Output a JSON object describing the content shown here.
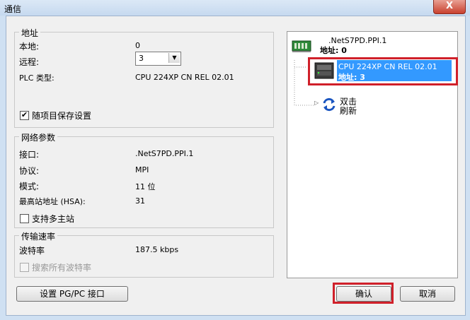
{
  "window": {
    "title": "通信",
    "close_glyph": "X"
  },
  "address": {
    "legend": "地址",
    "local_label": "本地:",
    "local_value": "0",
    "remote_label": "远程:",
    "remote_value": "3",
    "plc_type_label": "PLC 类型:",
    "plc_type_value": "CPU 224XP CN REL 02.01",
    "save_with_project_label": "随项目保存设置",
    "save_with_project_checked": true
  },
  "network": {
    "legend": "网络参数",
    "interface_label": "接口:",
    "interface_value": ".NetS7PD.PPI.1",
    "protocol_label": "协议:",
    "protocol_value": "MPI",
    "mode_label": "模式:",
    "mode_value": "11 位",
    "hsa_label": "最高站地址 (HSA):",
    "hsa_value": "31",
    "multi_master_label": "支持多主站",
    "multi_master_checked": false
  },
  "baud": {
    "legend": "传输速率",
    "baud_label": "波特率",
    "baud_value": "187.5 kbps",
    "search_all_label": "搜索所有波特率",
    "search_all_checked": false
  },
  "tree": {
    "root_name": ".NetS7PD.PPI.1",
    "root_address": "地址: 0",
    "device_name": "CPU 224XP CN REL 02.01",
    "device_address": "地址: 3",
    "refresh_line1": "双击",
    "refresh_line2": "刷新"
  },
  "buttons": {
    "setup_pgpc": "设置 PG/PC 接口",
    "ok": "确认",
    "cancel": "取消"
  },
  "colors": {
    "highlight_border": "#d0202a",
    "selection": "#3399ff"
  }
}
